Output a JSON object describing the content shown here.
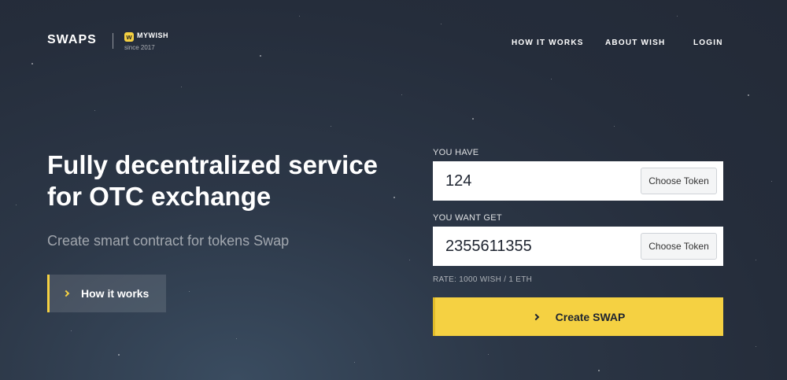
{
  "header": {
    "logo": "SWAPS",
    "brand_name": "MYWISH",
    "brand_since": "since 2017",
    "nav": [
      "HOW IT WORKS",
      "ABOUT WISH",
      "LOGIN"
    ]
  },
  "hero": {
    "title": "Fully decentralized service for OTC exchange",
    "subtitle": "Create smart contract for tokens Swap",
    "how_button": "How it works"
  },
  "form": {
    "have_label": "YOU HAVE",
    "have_value": "124",
    "want_label": "YOU WANT GET",
    "want_value": "2355611355",
    "choose_token": "Choose Token",
    "rate": "RATE: 1000 WISH / 1 ETH",
    "create_button": "Create SWAP"
  },
  "colors": {
    "accent": "#f5d142",
    "background": "#2a3342"
  }
}
